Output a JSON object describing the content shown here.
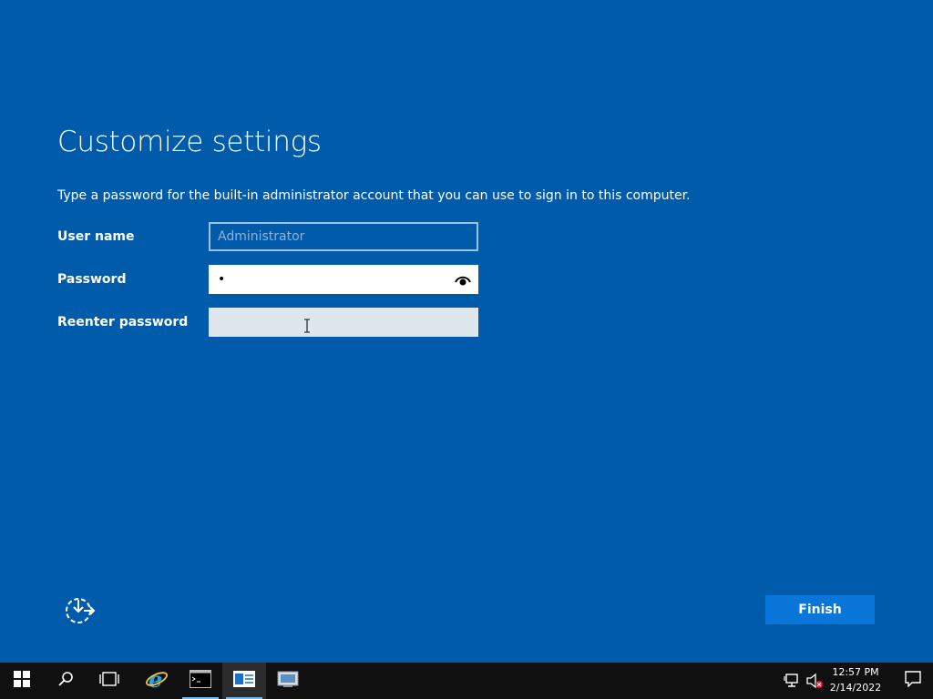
{
  "page": {
    "title": "Customize settings",
    "description": "Type a password for the built-in administrator account that you can use to sign in to this computer."
  },
  "form": {
    "username": {
      "label": "User name",
      "value": "Administrator"
    },
    "password": {
      "label": "Password",
      "value": "•",
      "reveal_icon": "eye-icon"
    },
    "reenter": {
      "label": "Reenter password",
      "value": ""
    }
  },
  "buttons": {
    "finish": "Finish",
    "accessibility_icon": "ease-of-access-icon"
  },
  "taskbar": {
    "items": [
      "start-icon",
      "search-icon",
      "task-view-icon",
      "internet-explorer-icon",
      "command-prompt-icon",
      "server-manager-icon",
      "setup-icon"
    ],
    "clock_time": "12:57 PM",
    "clock_date": "2/14/2022"
  },
  "colors": {
    "background": "#015bab",
    "finish_button": "#0a76d9",
    "taskbar": "#101010"
  }
}
